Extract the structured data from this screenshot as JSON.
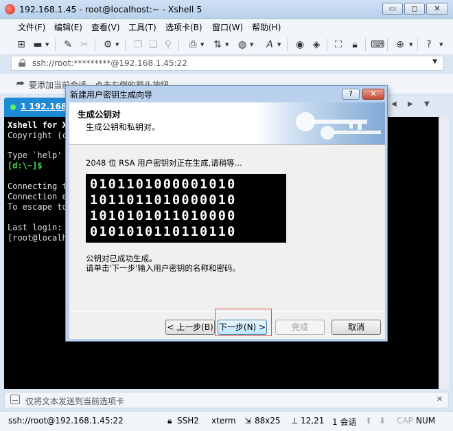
{
  "window": {
    "title": "192.168.1.45 - root@localhost:~ - Xshell 5",
    "minimize_glyph": "▭",
    "maximize_glyph": "◻",
    "close_glyph": "✕"
  },
  "menu": [
    "文件(F)",
    "编辑(E)",
    "查看(V)",
    "工具(T)",
    "选项卡(B)",
    "窗口(W)",
    "帮助(H)"
  ],
  "toolbar_icons": [
    "new-session-icon",
    "open-folder-icon",
    "pen-icon",
    "disconnect-icon",
    "properties-icon",
    "copy-icon",
    "paste-icon",
    "search-icon",
    "print-icon",
    "transfer-icon",
    "globe-icon",
    "font-icon",
    "xftp-icon",
    "xmanager-icon",
    "fullscreen-icon",
    "lock-icon",
    "keyboard-icon",
    "add-icon",
    "help-icon"
  ],
  "address": {
    "text": "ssh://root:*********@192.168.1.45:22"
  },
  "hint": {
    "text": "要添加当前会话，点击左侧的箭头按钮。"
  },
  "tab": {
    "label": "1 192.168.1"
  },
  "terminal": {
    "lines": [
      "Xshell for X",
      "Copyright (c",
      "",
      "Type `help'",
      "[d:\\~]$",
      "",
      "Connecting t",
      "Connection e",
      "To escape to",
      "",
      "Last login:",
      "[root@localh"
    ]
  },
  "sendbar": {
    "text": "仅将文本发送到当前选项卡"
  },
  "status": {
    "connection": "ssh://root@192.168.1.45:22",
    "protocol": "SSH2",
    "term": "xterm",
    "size": "88x25",
    "cursor": "12,21",
    "sessions": "1 会话",
    "caps": "CAP",
    "num": "NUM"
  },
  "dialog": {
    "title": "新建用户密钥生成向导",
    "help_label": "?",
    "close_label": "✕",
    "heading": "生成公钥对",
    "subheading": "生成公钥和私钥对。",
    "status_message": "2048 位 RSA 用户密钥对正在生成,请稍等...",
    "bits": [
      "0101101000001010",
      "1011011010000010",
      "1010101011010000",
      "0101010110110110"
    ],
    "done_line1": "公钥对已成功生成。",
    "done_line2": "请单击'下一步'输入用户密钥的名称和密码。",
    "buttons": {
      "back": "< 上一步(B)",
      "next": "下一步(N) >",
      "finish": "完成",
      "cancel": "取消"
    }
  }
}
